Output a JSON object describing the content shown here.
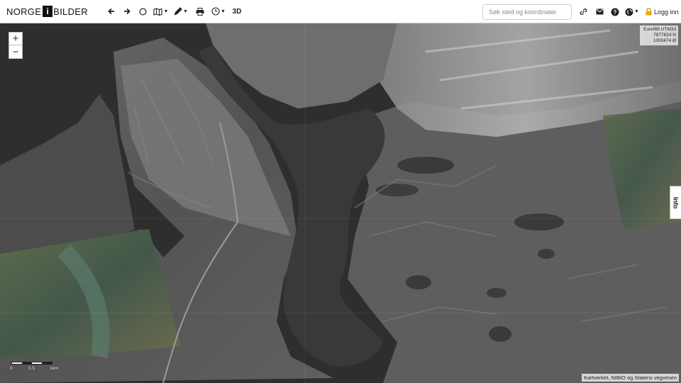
{
  "app": {
    "logo_left": "NORGE",
    "logo_mid": "i",
    "logo_right": "BILDER"
  },
  "toolbar": {
    "tools": [
      {
        "name": "back",
        "icon": "arrow-left-icon"
      },
      {
        "name": "forward",
        "icon": "arrow-right-icon"
      },
      {
        "name": "select-area",
        "icon": "circle-icon"
      },
      {
        "name": "basemap",
        "icon": "map-icon",
        "dropdown": true
      },
      {
        "name": "draw",
        "icon": "pencil-icon",
        "dropdown": true
      },
      {
        "name": "print",
        "icon": "printer-icon"
      },
      {
        "name": "time",
        "icon": "clock-icon",
        "dropdown": true
      }
    ],
    "mode_3d_label": "3D"
  },
  "search": {
    "placeholder": "Søk sted og koordinater",
    "value": ""
  },
  "right_tools": [
    {
      "name": "link",
      "icon": "link-icon"
    },
    {
      "name": "email",
      "icon": "envelope-icon"
    },
    {
      "name": "help",
      "icon": "question-icon"
    },
    {
      "name": "language",
      "icon": "globe-icon",
      "dropdown": true
    }
  ],
  "login": {
    "icon": "lock-icon",
    "label": "Logg inn"
  },
  "map": {
    "zoom_in": "+",
    "zoom_out": "−",
    "coordinates": {
      "system": "Euref89 UTM33",
      "north": "7877624 N",
      "east": "1000474 Ø"
    },
    "info_tab": "Info",
    "scale": {
      "labels": [
        "0",
        "0.5",
        "1km"
      ]
    },
    "attribution": "Kartverket, NIBIO og Statens vegvesen"
  },
  "colors": {
    "toolbar_bg": "#ffffff",
    "icon": "#222222",
    "water": "#3b3b3b",
    "land": "#5a5a5a"
  }
}
